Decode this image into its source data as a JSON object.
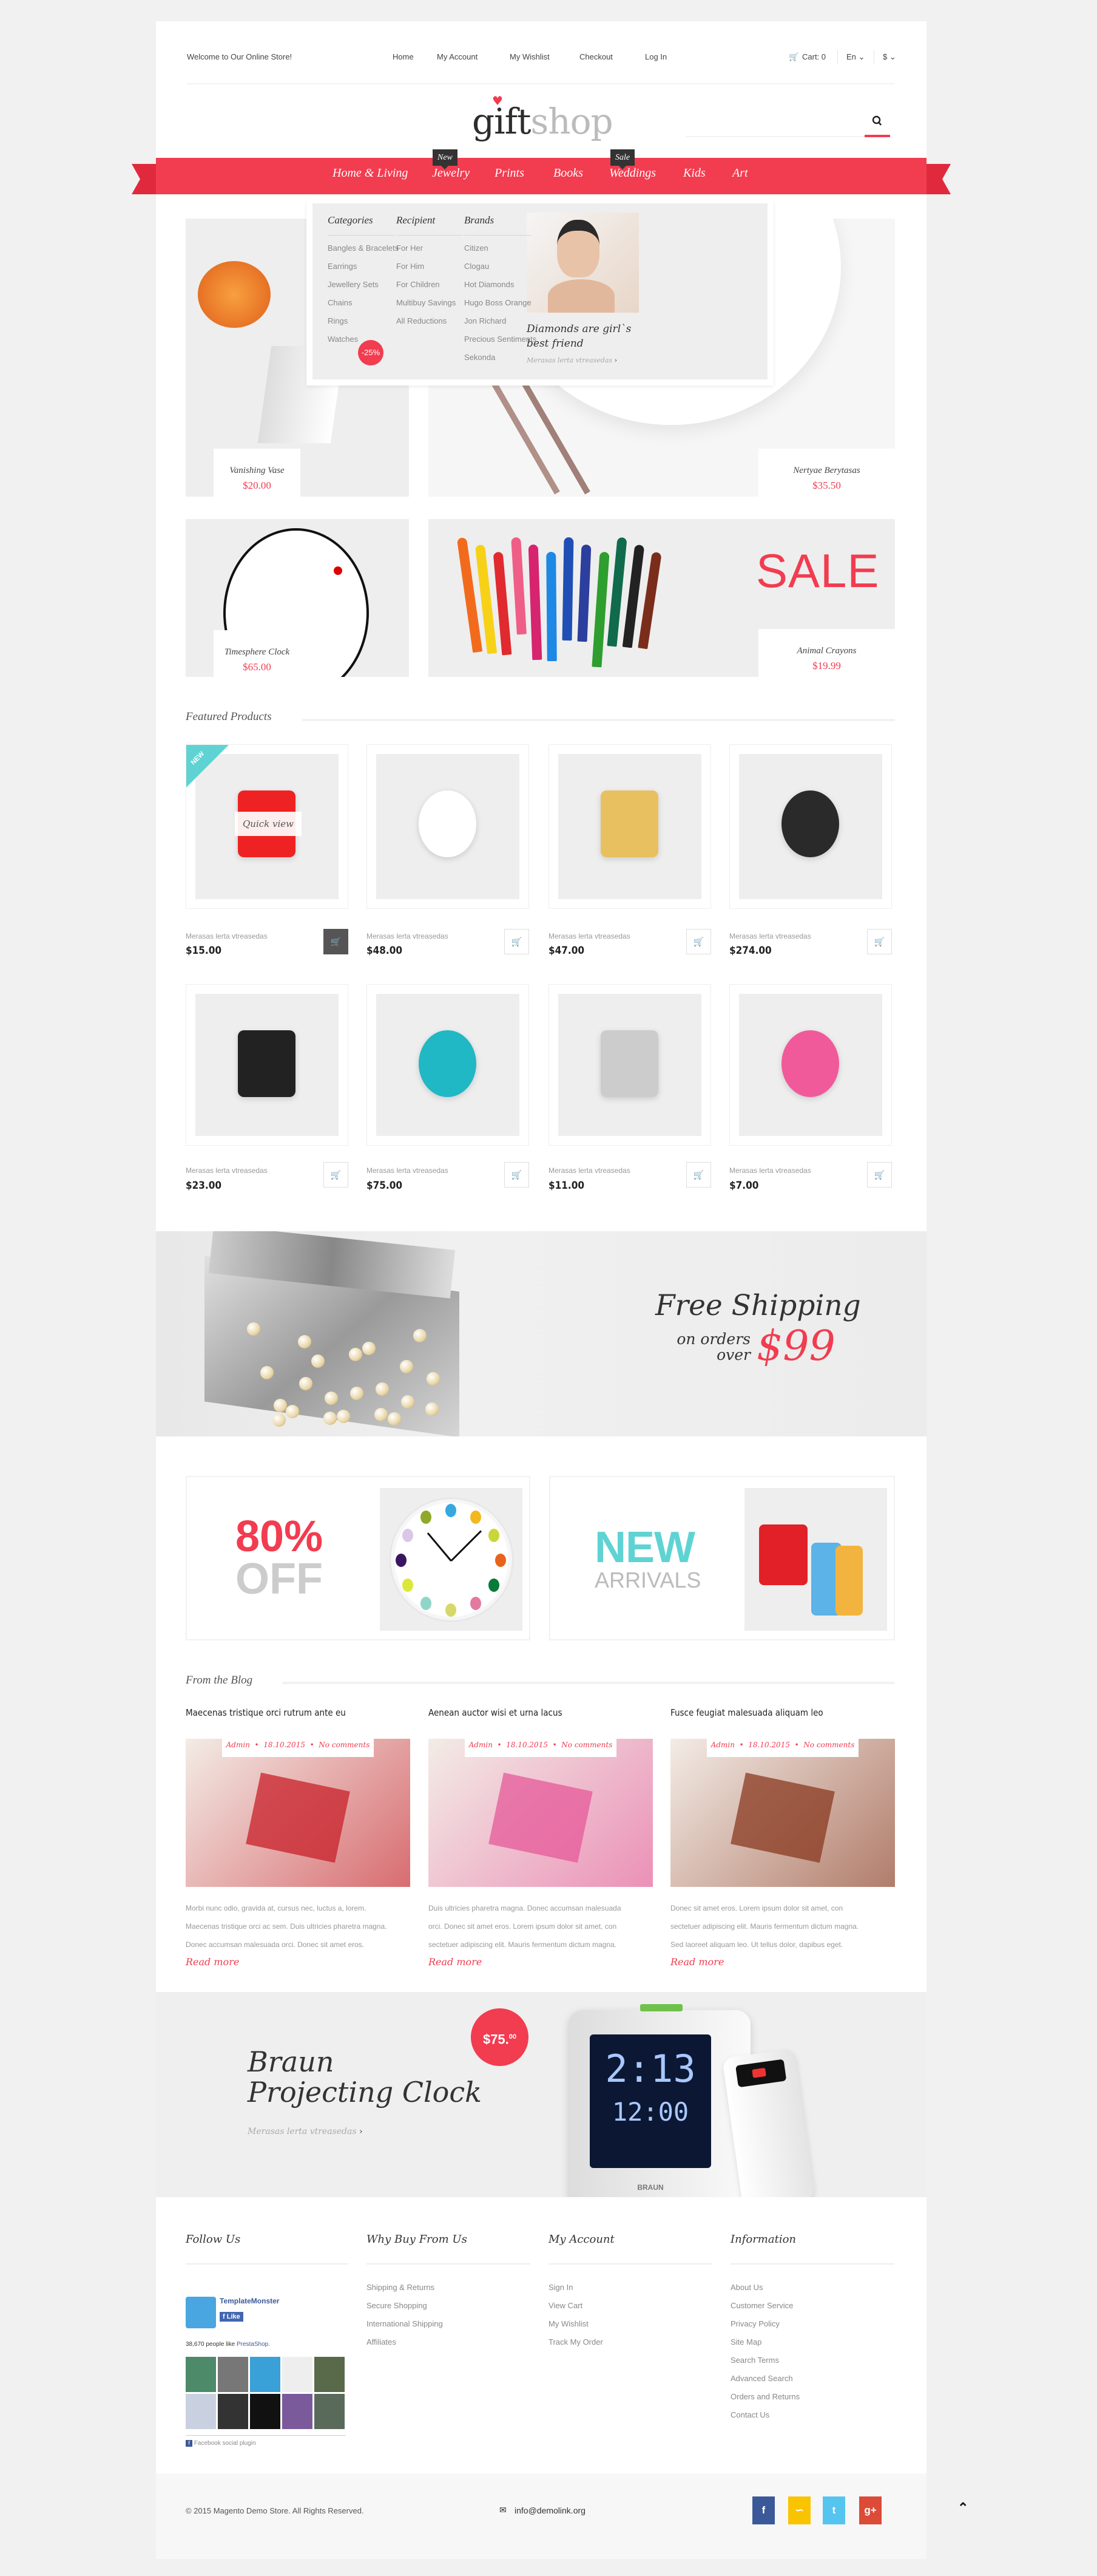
{
  "colors": {
    "accent": "#f23c50",
    "teal": "#5fd3d3",
    "dark": "#333333",
    "facebook": "#3b5998",
    "rss": "#f9c300",
    "twitter": "#55c5ef",
    "googleplus": "#dc4a38"
  },
  "topbar": {
    "welcome": "Welcome to Our Online Store!",
    "links": [
      "Home",
      "My Account",
      "My Wishlist",
      "Checkout",
      "Log In"
    ],
    "cart": "Cart: 0",
    "language": "En",
    "currency": "$"
  },
  "logo": {
    "part1": "gift",
    "part2": "shop"
  },
  "nav": {
    "items": [
      "Home & Living",
      "Jewelry",
      "Prints",
      "Books",
      "Weddings",
      "Kids",
      "Art"
    ],
    "badge_new": "New",
    "badge_sale": "Sale"
  },
  "mega": {
    "columns": [
      {
        "title": "Categories",
        "items": [
          "Bangles & Bracelets",
          "Earrings",
          "Jewellery Sets",
          "Chains",
          "Rings",
          "Watches"
        ]
      },
      {
        "title": "Recipient",
        "items": [
          "For Her",
          "For Him",
          "For Children",
          "Multibuy Savings",
          "All Reductions"
        ]
      },
      {
        "title": "Brands",
        "items": [
          "Citizen",
          "Clogau",
          "Hot Diamonds",
          "Hugo Boss Orange",
          "Jon Richard",
          "Precious Sentiments",
          "Sekonda"
        ]
      }
    ],
    "discount": "-25%",
    "promo_title": "Diamonds are girl`s best friend",
    "promo_link": "Merasas lerta vtreasedas"
  },
  "hero": [
    {
      "name": "Vanishing Vase",
      "price": "$20.00"
    },
    {
      "name": "Nertyae Berytasas",
      "price": "$35.50"
    },
    {
      "name": "Timesphere Clock",
      "price": "$65.00"
    },
    {
      "name": "Animal Crayons",
      "price": "$19.99"
    }
  ],
  "hero_sale": "SALE",
  "featured": {
    "title": "Featured Products",
    "badge": "NEW",
    "quick_view": "Quick view",
    "products": [
      {
        "desc": "Merasas lerta vtreasedas",
        "price": "$15.00"
      },
      {
        "desc": "Merasas lerta vtreasedas",
        "price": "$48.00"
      },
      {
        "desc": "Merasas lerta vtreasedas",
        "price": "$47.00"
      },
      {
        "desc": "Merasas lerta vtreasedas",
        "price": "$274.00"
      },
      {
        "desc": "Merasas lerta vtreasedas",
        "price": "$23.00"
      },
      {
        "desc": "Merasas lerta vtreasedas",
        "price": "$75.00"
      },
      {
        "desc": "Merasas lerta vtreasedas",
        "price": "$11.00"
      },
      {
        "desc": "Merasas lerta vtreasedas",
        "price": "$7.00"
      }
    ]
  },
  "shipping": {
    "title": "Free Shipping",
    "line1": "on orders",
    "line2": "over",
    "amount": "$99"
  },
  "promos": [
    {
      "big": "80%",
      "small": "OFF"
    },
    {
      "big": "NEW",
      "small": "ARRIVALS"
    }
  ],
  "blog": {
    "title": "From the Blog",
    "read_more": "Read more",
    "posts": [
      {
        "title": "Maecenas tristique orci rutrum ante eu",
        "meta": "Admin  •  18.10.2015  •  No comments",
        "lines": [
          "Morbi nunc odio, gravida at, cursus nec, luctus a, lorem.",
          "Maecenas tristique orci ac sem. Duis ultricies pharetra magna.",
          "Donec accumsan malesuada orci. Donec sit amet eros."
        ]
      },
      {
        "title": "Aenean auctor wisi et urna  lacus",
        "meta": "Admin  •  18.10.2015  •  No comments",
        "lines": [
          "Duis ultricies pharetra magna. Donec accumsan malesuada",
          "orci. Donec sit amet eros. Lorem ipsum dolor sit amet, con",
          "sectetuer adipiscing elit. Mauris fermentum dictum magna."
        ]
      },
      {
        "title": "Fusce feugiat malesuada aliquam leo",
        "meta": "Admin  •  18.10.2015  •  No comments",
        "lines": [
          "Donec sit amet eros. Lorem ipsum dolor sit amet, con",
          "sectetuer adipiscing elit. Mauris fermentum dictum magna.",
          "Sed laoreet aliquam leo. Ut tellus dolor, dapibus eget."
        ]
      }
    ]
  },
  "braun": {
    "line1": "Braun",
    "line2": "Projecting Clock",
    "link": "Merasas lerta vtreasedas",
    "price_main": "$75.",
    "price_cents": "00",
    "clock_top": "2:13",
    "clock_bottom": "12:00",
    "brand": "BRAUN"
  },
  "footer": {
    "follow": {
      "title": "Follow Us",
      "page_name": "TemplateMonster",
      "like": "Like",
      "count_text": "38,670 people like",
      "count_link": "PrestaShop.",
      "plugin": "Facebook social plugin"
    },
    "columns": [
      {
        "title": "Why Buy From Us",
        "links": [
          "Shipping & Returns",
          "Secure Shopping",
          "International Shipping",
          "Affiliates"
        ]
      },
      {
        "title": "My Account",
        "links": [
          "Sign In",
          "View Cart",
          "My Wishlist",
          "Track My Order"
        ]
      },
      {
        "title": "Information",
        "links": [
          "About Us",
          "Customer Service",
          "Privacy Policy",
          "Site Map",
          "Search Terms",
          "Advanced Search",
          "Orders and Returns",
          "Contact Us"
        ]
      }
    ]
  },
  "bottom": {
    "copyright": "© 2015 Magento Demo Store. All Rights Reserved.",
    "email": "info@demolink.org",
    "socials": [
      "facebook",
      "rss",
      "twitter",
      "google-plus"
    ]
  }
}
